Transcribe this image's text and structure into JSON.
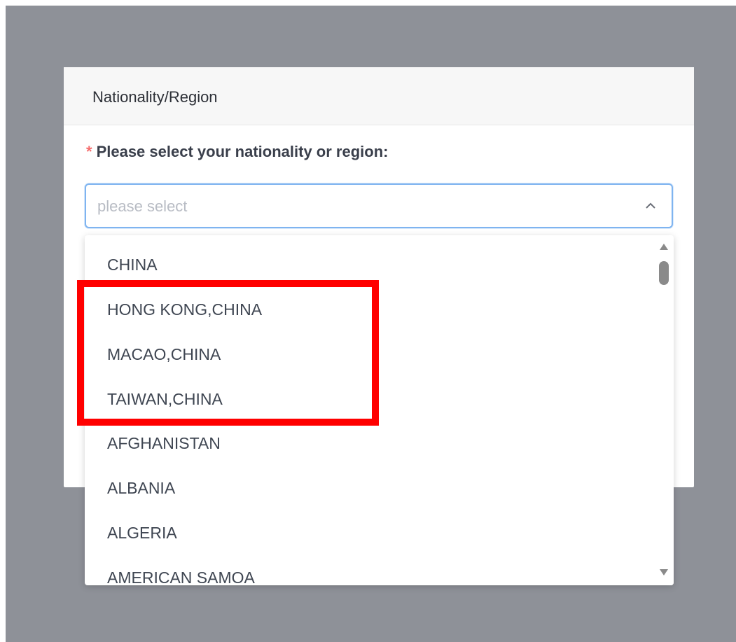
{
  "modal": {
    "title": "Nationality/Region",
    "field_label": "Please select your nationality or region:",
    "required_marker": "*",
    "select": {
      "placeholder": "please select",
      "state": "open",
      "arrow_icon": "chevron-up-icon"
    }
  },
  "dropdown": {
    "options": [
      "CHINA",
      "HONG KONG,CHINA",
      "MACAO,CHINA",
      "TAIWAN,CHINA",
      "AFGHANISTAN",
      "ALBANIA",
      "ALGERIA",
      "AMERICAN SAMOA"
    ],
    "highlighted_options": [
      "HONG KONG,CHINA",
      "MACAO,CHINA",
      "TAIWAN,CHINA"
    ]
  },
  "colors": {
    "overlay": "#8e9198",
    "required_star": "#f56c6c",
    "select_border_focus": "#7fb4f0",
    "highlight": "#ff0000",
    "option_text": "#3f4652"
  }
}
